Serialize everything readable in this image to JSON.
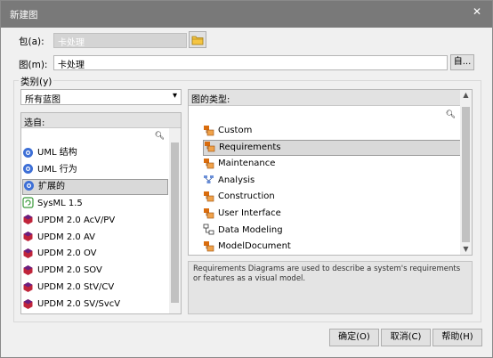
{
  "window": {
    "title": "新建图",
    "close_glyph": "✕"
  },
  "package": {
    "label": "包(a):",
    "value": "卡处理"
  },
  "diagram": {
    "label": "图(m):",
    "value": "卡处理",
    "ellipsis_button": "自..."
  },
  "category": {
    "label": "类别(y)",
    "dropdown_value": "所有蓝图",
    "select_header": "选自:",
    "items": [
      {
        "label": "UML 结构",
        "icon": "uml-icon"
      },
      {
        "label": "UML 行为",
        "icon": "uml-icon"
      },
      {
        "label": "扩展的",
        "icon": "uml-icon",
        "selected": true
      },
      {
        "label": "SysML 1.5",
        "icon": "sysml-icon"
      },
      {
        "label": "UPDM 2.0 AcV/PV",
        "icon": "hexagon-icon"
      },
      {
        "label": "UPDM 2.0 AV",
        "icon": "hexagon-icon"
      },
      {
        "label": "UPDM 2.0 OV",
        "icon": "hexagon-icon"
      },
      {
        "label": "UPDM 2.0 SOV",
        "icon": "hexagon-icon"
      },
      {
        "label": "UPDM 2.0 StV/CV",
        "icon": "hexagon-icon"
      },
      {
        "label": "UPDM 2.0 SV/SvcV",
        "icon": "hexagon-icon"
      }
    ]
  },
  "diagram_types": {
    "header": "图的类型:",
    "items": [
      {
        "label": "Custom",
        "icon": "requirement-icon"
      },
      {
        "label": "Requirements",
        "icon": "requirement-icon",
        "selected": true
      },
      {
        "label": "Maintenance",
        "icon": "requirement-icon"
      },
      {
        "label": "Analysis",
        "icon": "analysis-icon"
      },
      {
        "label": "Construction",
        "icon": "requirement-icon"
      },
      {
        "label": "User Interface",
        "icon": "requirement-icon"
      },
      {
        "label": "Data Modeling",
        "icon": "data-modeling-icon"
      },
      {
        "label": "ModelDocument",
        "icon": "requirement-icon"
      }
    ]
  },
  "description": "Requirements Diagrams are used to describe a system's requirements or features as a visual model.",
  "buttons": {
    "ok": "确定(O)",
    "cancel": "取消(C)",
    "help": "帮助(H)"
  },
  "colors": {
    "titlebar": "#797979",
    "selection": "#d9d9d9",
    "dialog_bg": "#f0f0f0"
  }
}
